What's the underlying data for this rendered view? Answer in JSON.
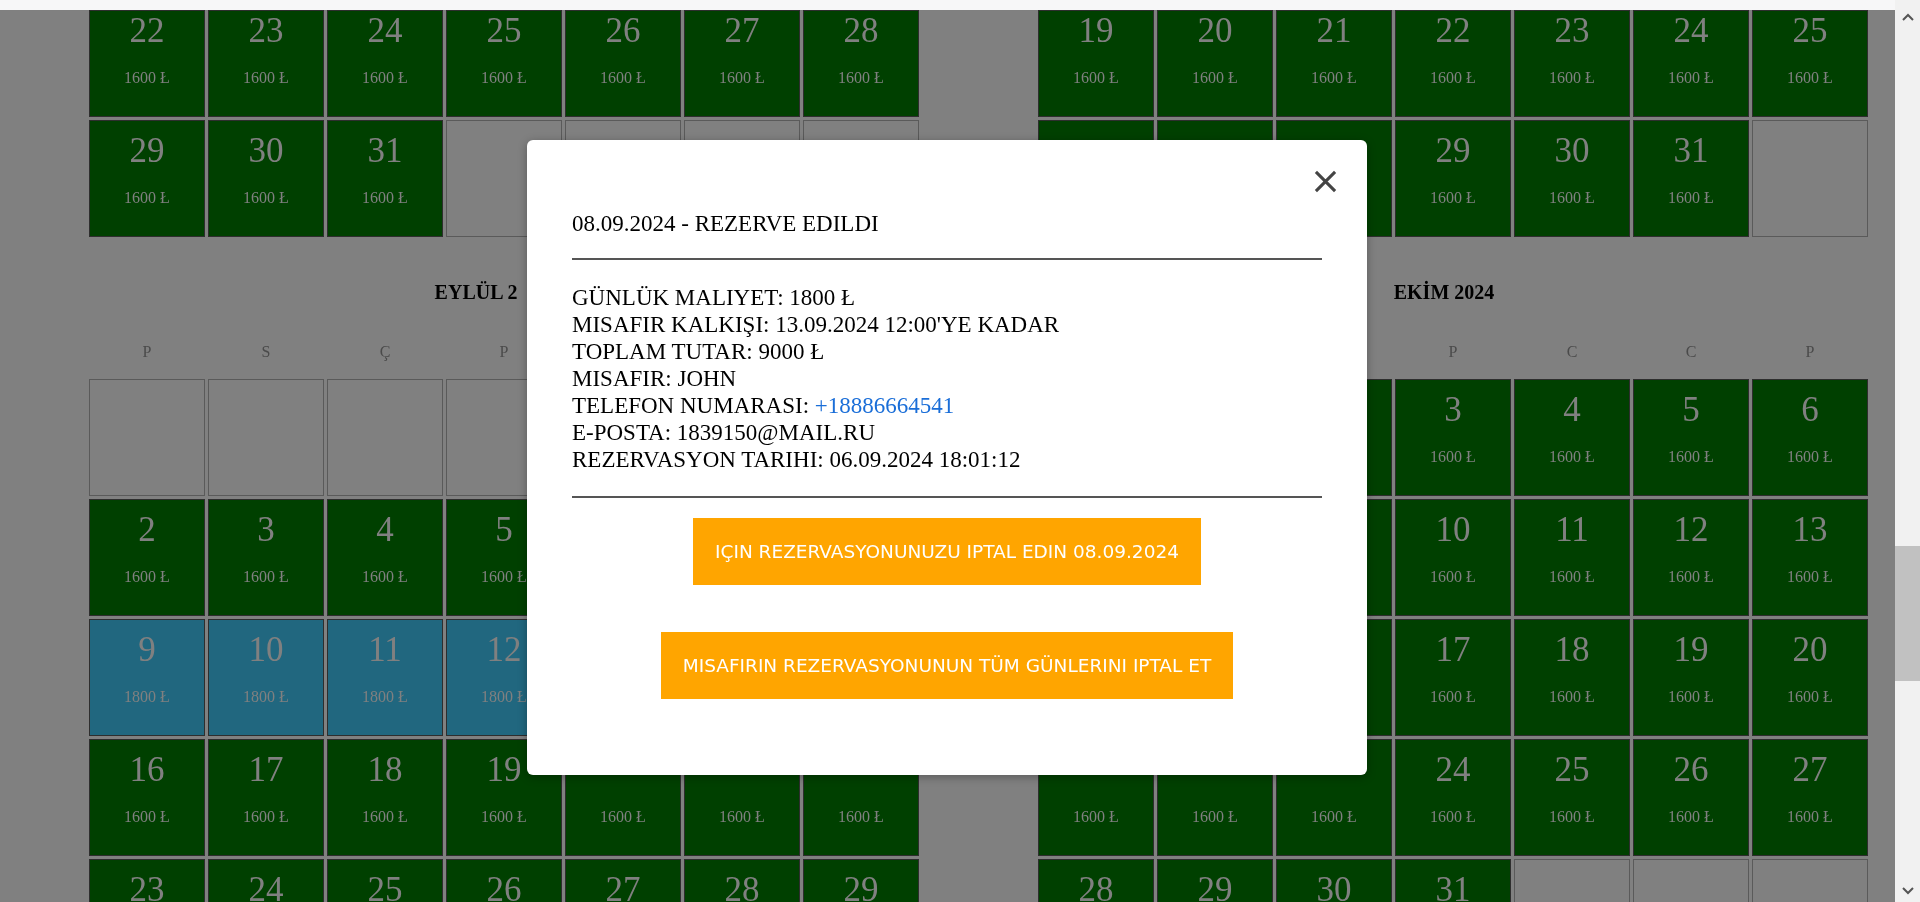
{
  "calendars": [
    {
      "previous_month_rows": [
        [
          {
            "kind": "free",
            "day": "22",
            "price": "1600 Ł"
          },
          {
            "kind": "free",
            "day": "23",
            "price": "1600 Ł"
          },
          {
            "kind": "free",
            "day": "24",
            "price": "1600 Ł"
          },
          {
            "kind": "free",
            "day": "25",
            "price": "1600 Ł"
          },
          {
            "kind": "free",
            "day": "26",
            "price": "1600 Ł"
          },
          {
            "kind": "free",
            "day": "27",
            "price": "1600 Ł"
          },
          {
            "kind": "free",
            "day": "28",
            "price": "1600 Ł"
          }
        ],
        [
          {
            "kind": "free",
            "day": "29",
            "price": "1600 Ł"
          },
          {
            "kind": "free",
            "day": "30",
            "price": "1600 Ł"
          },
          {
            "kind": "free",
            "day": "31",
            "price": "1600 Ł"
          },
          {
            "kind": "empty"
          },
          {
            "kind": "empty"
          },
          {
            "kind": "empty"
          },
          {
            "kind": "empty"
          }
        ]
      ],
      "month": {
        "title": "EYLÜL 2",
        "weekdays": [
          {
            "kind": "label",
            "text": "P"
          },
          {
            "kind": "label",
            "text": "S"
          },
          {
            "kind": "label",
            "text": "Ç"
          },
          {
            "kind": "label",
            "text": "P"
          },
          {
            "kind": "covered"
          },
          {
            "kind": "covered"
          },
          {
            "kind": "covered"
          }
        ],
        "rows": [
          [
            {
              "kind": "empty"
            },
            {
              "kind": "empty"
            },
            {
              "kind": "empty"
            },
            {
              "kind": "empty"
            },
            {
              "kind": "covered"
            },
            {
              "kind": "covered"
            },
            {
              "kind": "covered"
            }
          ],
          [
            {
              "kind": "free",
              "day": "2",
              "price": "1600 Ł"
            },
            {
              "kind": "free",
              "day": "3",
              "price": "1600 Ł"
            },
            {
              "kind": "free",
              "day": "4",
              "price": "1600 Ł"
            },
            {
              "kind": "free",
              "day": "5",
              "price": "1600 Ł"
            },
            {
              "kind": "covered"
            },
            {
              "kind": "covered"
            },
            {
              "kind": "covered"
            }
          ],
          [
            {
              "kind": "booked",
              "day": "9",
              "price": "1800 Ł"
            },
            {
              "kind": "booked",
              "day": "10",
              "price": "1800 Ł"
            },
            {
              "kind": "booked",
              "day": "11",
              "price": "1800 Ł"
            },
            {
              "kind": "booked",
              "day": "12",
              "price": "1800 Ł"
            },
            {
              "kind": "covered"
            },
            {
              "kind": "covered"
            },
            {
              "kind": "covered"
            }
          ],
          [
            {
              "kind": "free",
              "day": "16",
              "price": "1600 Ł"
            },
            {
              "kind": "free",
              "day": "17",
              "price": "1600 Ł"
            },
            {
              "kind": "free",
              "day": "18",
              "price": "1600 Ł"
            },
            {
              "kind": "free",
              "day": "19",
              "price": "1600 Ł"
            },
            {
              "kind": "free",
              "price": "1600 Ł"
            },
            {
              "kind": "free",
              "price": "1600 Ł"
            },
            {
              "kind": "free",
              "price": "1600 Ł"
            }
          ],
          [
            {
              "kind": "free",
              "day": "23"
            },
            {
              "kind": "free",
              "day": "24"
            },
            {
              "kind": "free",
              "day": "25"
            },
            {
              "kind": "free",
              "day": "26"
            },
            {
              "kind": "free",
              "day": "27"
            },
            {
              "kind": "free",
              "day": "28"
            },
            {
              "kind": "free",
              "day": "29"
            }
          ]
        ]
      }
    },
    {
      "previous_month_rows": [
        [
          {
            "kind": "free",
            "day": "19",
            "price": "1600 Ł"
          },
          {
            "kind": "free",
            "day": "20",
            "price": "1600 Ł"
          },
          {
            "kind": "free",
            "day": "21",
            "price": "1600 Ł"
          },
          {
            "kind": "free",
            "day": "22",
            "price": "1600 Ł"
          },
          {
            "kind": "free",
            "day": "23",
            "price": "1600 Ł"
          },
          {
            "kind": "free",
            "day": "24",
            "price": "1600 Ł"
          },
          {
            "kind": "free",
            "day": "25",
            "price": "1600 Ł"
          }
        ],
        [
          {
            "kind": "free"
          },
          {
            "kind": "free"
          },
          {
            "kind": "free"
          },
          {
            "kind": "free",
            "day": "29",
            "price": "1600 Ł"
          },
          {
            "kind": "free",
            "day": "30",
            "price": "1600 Ł"
          },
          {
            "kind": "free",
            "day": "31",
            "price": "1600 Ł"
          },
          {
            "kind": "empty"
          }
        ]
      ],
      "month": {
        "title": "EKİM 2024",
        "weekdays": [
          {
            "kind": "covered"
          },
          {
            "kind": "covered"
          },
          {
            "kind": "covered"
          },
          {
            "kind": "label",
            "text": "P"
          },
          {
            "kind": "label",
            "text": "C"
          },
          {
            "kind": "label",
            "text": "C"
          },
          {
            "kind": "label",
            "text": "P"
          }
        ],
        "rows": [
          [
            {
              "kind": "covered"
            },
            {
              "kind": "covered"
            },
            {
              "kind": "covered"
            },
            {
              "kind": "free",
              "day": "3",
              "price": "1600 Ł"
            },
            {
              "kind": "free",
              "day": "4",
              "price": "1600 Ł"
            },
            {
              "kind": "free",
              "day": "5",
              "price": "1600 Ł"
            },
            {
              "kind": "free",
              "day": "6",
              "price": "1600 Ł"
            }
          ],
          [
            {
              "kind": "covered"
            },
            {
              "kind": "covered"
            },
            {
              "kind": "covered"
            },
            {
              "kind": "free",
              "day": "10",
              "price": "1600 Ł"
            },
            {
              "kind": "free",
              "day": "11",
              "price": "1600 Ł"
            },
            {
              "kind": "free",
              "day": "12",
              "price": "1600 Ł"
            },
            {
              "kind": "free",
              "day": "13",
              "price": "1600 Ł"
            }
          ],
          [
            {
              "kind": "covered"
            },
            {
              "kind": "covered"
            },
            {
              "kind": "covered"
            },
            {
              "kind": "free",
              "day": "17",
              "price": "1600 Ł"
            },
            {
              "kind": "free",
              "day": "18",
              "price": "1600 Ł"
            },
            {
              "kind": "free",
              "day": "19",
              "price": "1600 Ł"
            },
            {
              "kind": "free",
              "day": "20",
              "price": "1600 Ł"
            }
          ],
          [
            {
              "kind": "free",
              "price": "1600 Ł"
            },
            {
              "kind": "free",
              "price": "1600 Ł"
            },
            {
              "kind": "free",
              "price": "1600 Ł"
            },
            {
              "kind": "free",
              "day": "24",
              "price": "1600 Ł"
            },
            {
              "kind": "free",
              "day": "25",
              "price": "1600 Ł"
            },
            {
              "kind": "free",
              "day": "26",
              "price": "1600 Ł"
            },
            {
              "kind": "free",
              "day": "27",
              "price": "1600 Ł"
            }
          ],
          [
            {
              "kind": "free",
              "day": "28"
            },
            {
              "kind": "free",
              "day": "29"
            },
            {
              "kind": "free",
              "day": "30"
            },
            {
              "kind": "free",
              "day": "31"
            },
            {
              "kind": "empty"
            },
            {
              "kind": "empty"
            },
            {
              "kind": "empty"
            }
          ]
        ]
      }
    }
  ],
  "modal": {
    "title": "08.09.2024 - REZERVE EDILDI",
    "details": [
      {
        "kind": "text",
        "label": "GÜNLÜK MALIYET:",
        "value": "1800 Ł"
      },
      {
        "kind": "text",
        "label": "MISAFIR KALKIŞI:",
        "value": "13.09.2024 12:00'YE KADAR"
      },
      {
        "kind": "text",
        "label": "TOPLAM TUTAR:",
        "value": "9000 Ł"
      },
      {
        "kind": "text",
        "label": "MISAFIR:",
        "value": "JOHN"
      },
      {
        "kind": "link",
        "label": "TELEFON NUMARASI:",
        "value": "+18886664541"
      },
      {
        "kind": "text",
        "label": "E-POSTA:",
        "value": "1839150@MAIL.RU"
      },
      {
        "kind": "text",
        "label": "REZERVASYON TARIHI:",
        "value": "06.09.2024 18:01:12"
      }
    ],
    "buttons": [
      "IÇIN REZERVASYONUNUZU IPTAL EDIN 08.09.2024",
      "MISAFIRIN REZERVASYONUNUN TÜM GÜNLERINI IPTAL ET"
    ]
  }
}
